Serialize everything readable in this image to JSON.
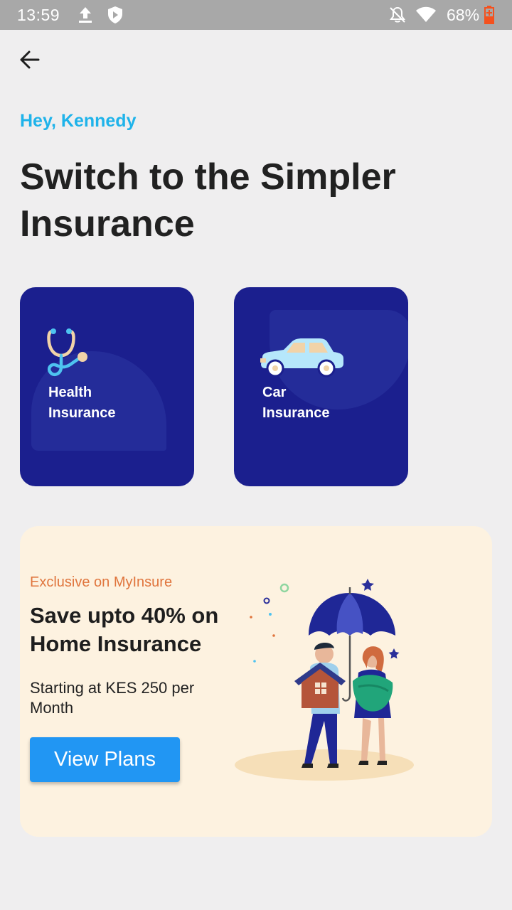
{
  "status_bar": {
    "time": "13:59",
    "battery_percent": "68%",
    "icons": [
      "upload-icon",
      "shield-icon",
      "notifications-off-icon",
      "wifi-icon",
      "battery-charging-icon"
    ]
  },
  "header": {
    "back_icon": "arrow-back-icon"
  },
  "greeting": "Hey, Kennedy",
  "title": "Switch to the Simpler Insurance",
  "cards": [
    {
      "line1": "Health",
      "line2": "Insurance",
      "icon": "stethoscope-icon"
    },
    {
      "line1": "Car",
      "line2": "Insurance",
      "icon": "car-icon"
    }
  ],
  "promo": {
    "eyebrow": "Exclusive on MyInsure",
    "title": "Save upto 40% on Home Insurance",
    "subtitle": "Starting at KES 250 per Month",
    "button_label": "View Plans",
    "illustration": "couple-umbrella-house-illustration"
  },
  "colors": {
    "accent": "#1fb3ea",
    "card_bg": "#1b1f8e",
    "promo_bg": "#fdf2e0",
    "eyebrow": "#e0753d",
    "button": "#2196f3",
    "status_bar": "#a8a8a8"
  }
}
